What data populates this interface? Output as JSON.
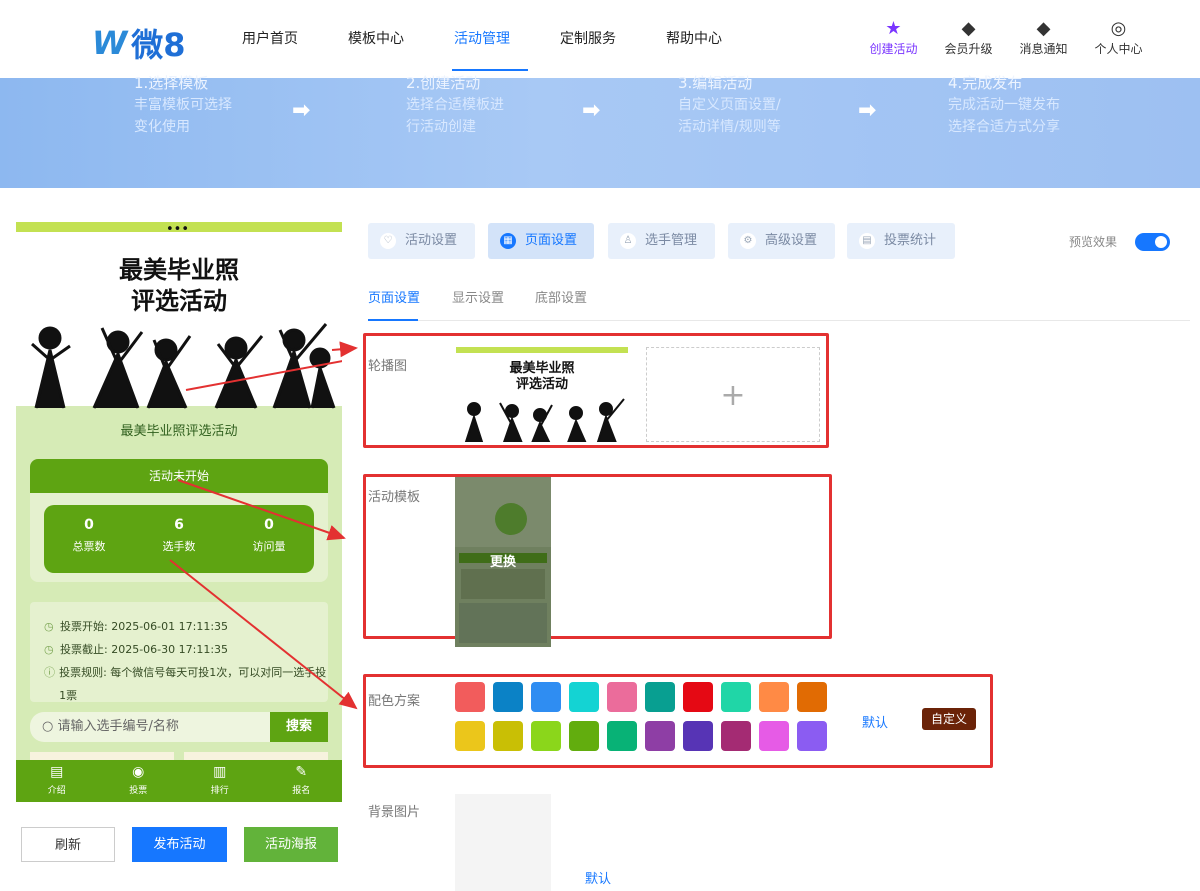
{
  "header": {
    "logo": "微8",
    "nav": [
      "用户首页",
      "模板中心",
      "活动管理",
      "定制服务",
      "帮助中心"
    ],
    "tools": [
      "创建活动",
      "会员升级",
      "消息通知",
      "个人中心"
    ]
  },
  "banner": {
    "steps": [
      {
        "title": "1.选择模板",
        "line1": "丰富模板可选择",
        "line2": "变化使用"
      },
      {
        "title": "2.创建活动",
        "line1": "选择合适模板进",
        "line2": "行活动创建"
      },
      {
        "title": "3.编辑活动",
        "line1": "自定义页面设置/",
        "line2": "活动详情/规则等"
      },
      {
        "title": "4.完成发布",
        "line1": "完成活动一键发布",
        "line2": "选择合适方式分享"
      }
    ]
  },
  "poster": {
    "dots": "•••",
    "title_line1": "最美毕业照",
    "title_line2": "评选活动",
    "activity_name": "最美毕业照评选活动",
    "status": "活动未开始"
  },
  "stats": [
    {
      "value": "0",
      "label": "总票数"
    },
    {
      "value": "6",
      "label": "选手数"
    },
    {
      "value": "0",
      "label": "访问量"
    }
  ],
  "info": {
    "start": "投票开始: 2025-06-01 17:11:35",
    "end": "投票截止: 2025-06-30 17:11:35",
    "rule": "投票规则: 每个微信号每天可投1次，可以对同一选手投1票"
  },
  "search": {
    "placeholder": "请输入选手编号/名称",
    "button": "搜索"
  },
  "tabbar": [
    "介绍",
    "投票",
    "排行",
    "报名"
  ],
  "left_buttons": [
    "刷新",
    "发布活动",
    "活动海报"
  ],
  "settings_tabs": [
    "活动设置",
    "页面设置",
    "选手管理",
    "高级设置",
    "投票统计"
  ],
  "preview_label": "预览效果",
  "subtabs": [
    "页面设置",
    "显示设置",
    "底部设置"
  ],
  "labels": {
    "carousel": "轮播图",
    "template": "活动模板",
    "colors": "配色方案",
    "background": "背景图片"
  },
  "template": {
    "change_label": "更换"
  },
  "carousel_thumb": {
    "line1": "最美毕业照",
    "line2": "评选活动"
  },
  "color_actions": {
    "default": "默认",
    "custom": "自定义"
  },
  "background": {
    "default": "默认"
  },
  "palette": [
    "#f25c5c",
    "#0b82c6",
    "#2f8df2",
    "#14d3d3",
    "#eb6c9b",
    "#089f91",
    "#e50914",
    "#20d6a7",
    "#ff8a45",
    "#e16b03",
    "#ebc61b",
    "#c9bf05",
    "#8bd61b",
    "#62ad0e",
    "#08b276",
    "#8e3ea5",
    "#5734b5",
    "#a42b73",
    "#e65be6",
    "#8b5cf2"
  ]
}
